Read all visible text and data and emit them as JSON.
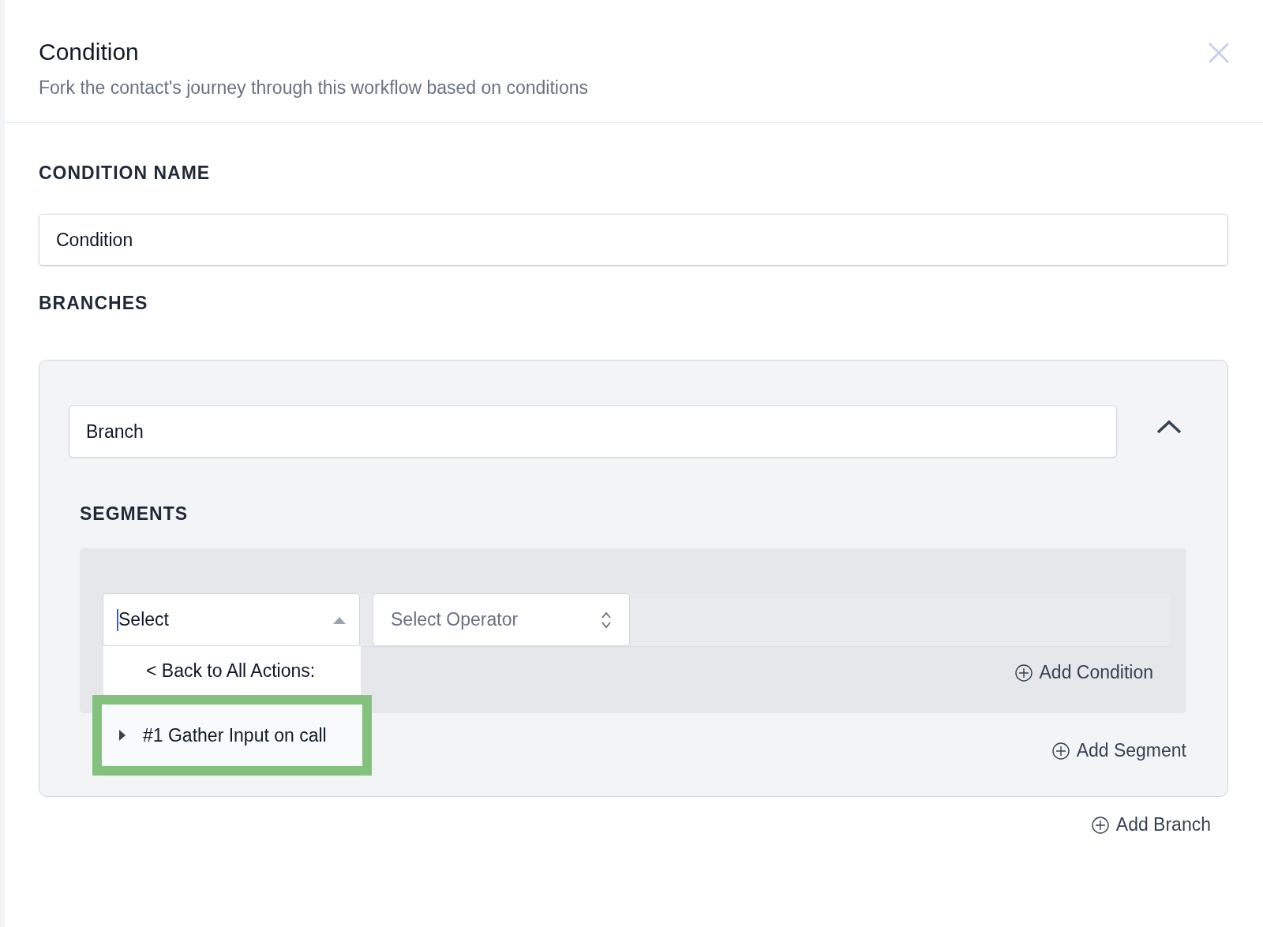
{
  "header": {
    "title": "Condition",
    "subtitle": "Fork the contact's journey through this workflow based on conditions"
  },
  "condition_name": {
    "label": "CONDITION NAME",
    "value": "Condition"
  },
  "branches": {
    "label": "BRANCHES",
    "items": [
      {
        "name": "Branch",
        "expanded": true,
        "segments_label": "SEGMENTS",
        "field_select": {
          "value": "Select",
          "open": true,
          "options": [
            {
              "kind": "back",
              "label": "< Back to All Actions:",
              "highlighted": false
            },
            {
              "kind": "group",
              "label": "#1 Gather Input on call",
              "highlighted": true
            }
          ]
        },
        "operator_select": {
          "placeholder": "Select Operator"
        },
        "add_condition": "Add Condition",
        "add_segment": "Add Segment"
      }
    ],
    "add_branch": "Add Branch"
  }
}
